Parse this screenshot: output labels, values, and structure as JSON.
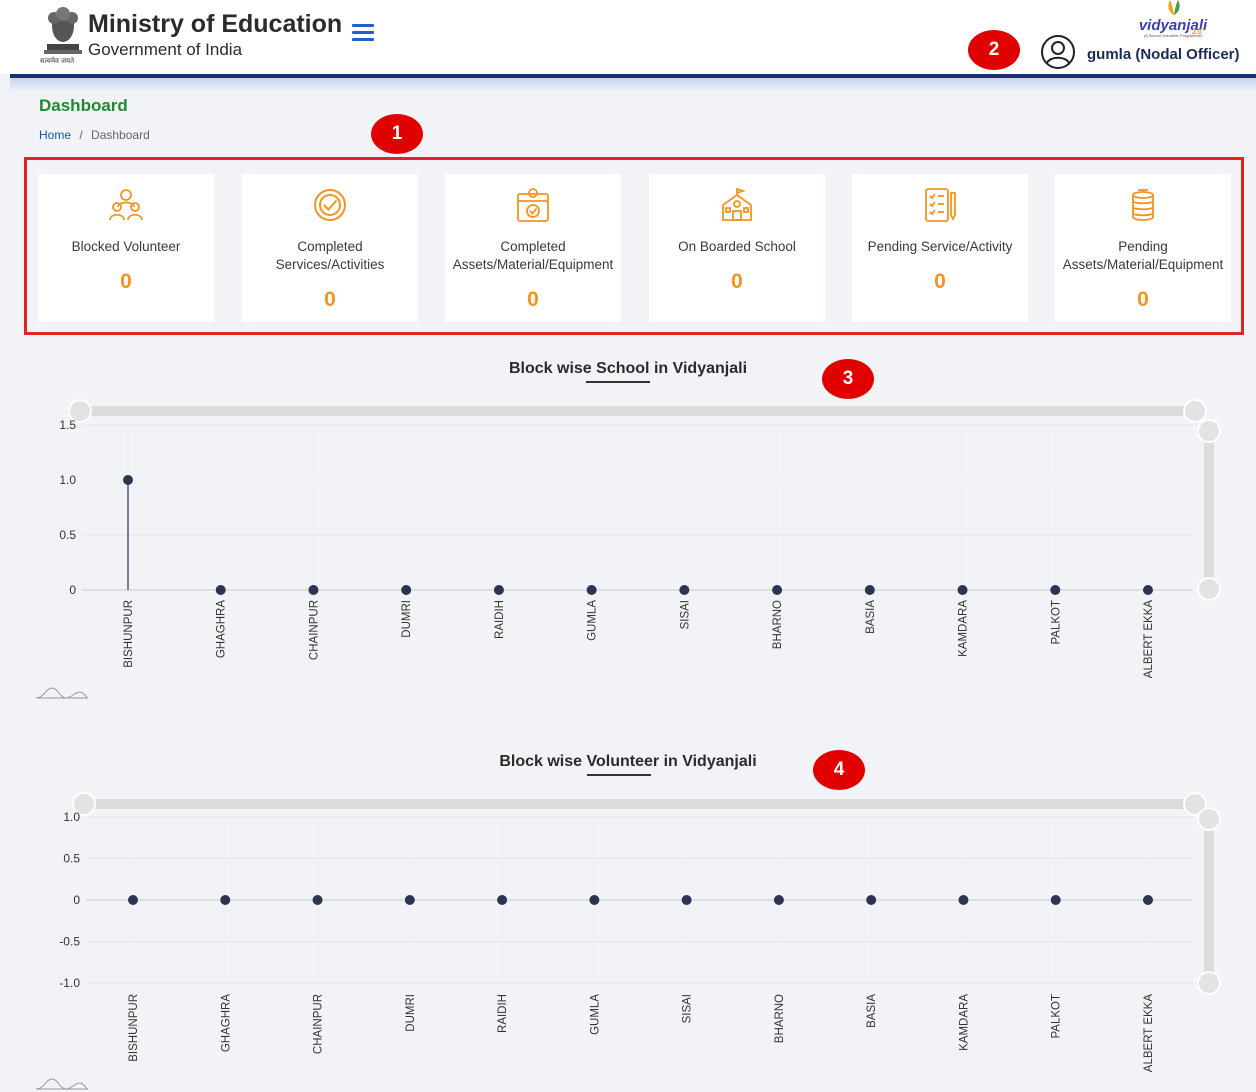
{
  "header": {
    "title": "Ministry of Education",
    "subtitle": "Government of India",
    "motto": "सत्यमेव जयते",
    "logo_text": "vidyanjali",
    "logo_version": "2.0",
    "logo_tagline": "(A School Volunteer Programme)",
    "user_label": "gumla (Nodal Officer)",
    "menu_icon": "hamburger-icon",
    "user_icon": "user-circle-icon"
  },
  "page": {
    "title": "Dashboard",
    "breadcrumb_home": "Home",
    "breadcrumb_sep": "/",
    "breadcrumb_current": "Dashboard"
  },
  "markers": [
    "1",
    "2",
    "3",
    "4"
  ],
  "cards": [
    {
      "label_1": "Blocked Volunteer",
      "label_2": "",
      "value": "0",
      "icon": "volunteers-icon"
    },
    {
      "label_1": "Completed",
      "label_2": "Services/Activities",
      "value": "0",
      "icon": "check-circle-icon"
    },
    {
      "label_1": "Completed",
      "label_2": "Assets/Material/Equipment",
      "value": "0",
      "icon": "calendar-check-icon"
    },
    {
      "label_1": "On Boarded School",
      "label_2": "",
      "value": "0",
      "icon": "school-icon"
    },
    {
      "label_1": "Pending Service/Activity",
      "label_2": "",
      "value": "0",
      "icon": "checklist-icon"
    },
    {
      "label_1": "Pending",
      "label_2": "Assets/Material/Equipment",
      "value": "0",
      "icon": "coins-icon"
    }
  ],
  "colors": {
    "accent_orange": "#f39423",
    "header_navy": "#1b2f6e",
    "title_green": "#1f8a2e",
    "marker_red": "#e00000",
    "series": "#2b3553"
  },
  "chart_data": [
    {
      "type": "line",
      "title_prefix": "Block wise",
      "title_keyword": "School",
      "title_suffix": "in Vidyanjali",
      "categories": [
        "BISHUNPUR",
        "GHAGHRA",
        "CHAINPUR",
        "DUMRI",
        "RAIDIH",
        "GUMLA",
        "SISAI",
        "BHARNO",
        "BASIA",
        "KAMDARA",
        "PALKOT",
        "ALBERT EKKA"
      ],
      "values": [
        1,
        0,
        0,
        0,
        0,
        0,
        0,
        0,
        0,
        0,
        0,
        0
      ],
      "yticks": [
        "1.5",
        "1.0",
        "0.5",
        "0"
      ],
      "ylim": [
        0,
        1.5
      ],
      "grid": true,
      "drop_lines": true
    },
    {
      "type": "line",
      "title_prefix": "Block wise",
      "title_keyword": "Volunteer",
      "title_suffix": "in Vidyanjali",
      "categories": [
        "BISHUNPUR",
        "GHAGHRA",
        "CHAINPUR",
        "DUMRI",
        "RAIDIH",
        "GUMLA",
        "SISAI",
        "BHARNO",
        "BASIA",
        "KAMDARA",
        "PALKOT",
        "ALBERT EKKA"
      ],
      "values": [
        0,
        0,
        0,
        0,
        0,
        0,
        0,
        0,
        0,
        0,
        0,
        0
      ],
      "yticks": [
        "1.0",
        "0.5",
        "0",
        "-0.5",
        "-1.0"
      ],
      "ylim": [
        -1,
        1
      ],
      "grid": true,
      "drop_lines": true
    }
  ]
}
